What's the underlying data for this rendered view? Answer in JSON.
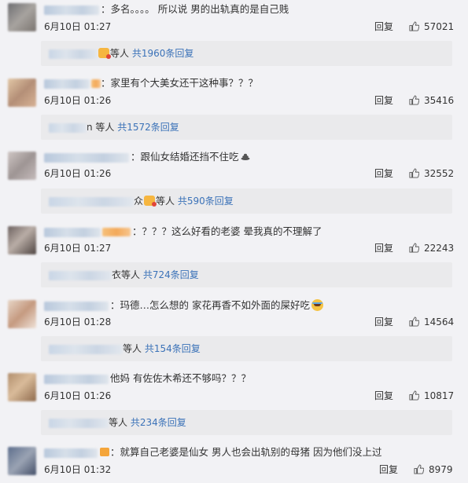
{
  "comments": [
    {
      "text": "：多名。。。。 所以说 男的出轨真的是自己贱",
      "time": "6月10日 01:27",
      "reply_label": "回复",
      "likes": "57021",
      "sub": {
        "suffix": "等人",
        "link": "共1960条回复"
      }
    },
    {
      "text": "：家里有个大美女还干这种事？？？",
      "time": "6月10日 01:26",
      "reply_label": "回复",
      "likes": "35416",
      "sub": {
        "suffix": "n 等人",
        "link": "共1572条回复"
      }
    },
    {
      "text": "：跟仙女结婚还挡不住吃",
      "time": "6月10日 01:26",
      "reply_label": "回复",
      "likes": "32552",
      "sub": {
        "suffix": "众",
        "suffix2": "等人",
        "link": "共590条回复"
      }
    },
    {
      "text": "：？？？这么好看的老婆 晕我真的不理解了",
      "time": "6月10日 01:27",
      "reply_label": "回复",
      "likes": "22243",
      "sub": {
        "suffix": "衣等人",
        "link": "共724条回复"
      }
    },
    {
      "text": "：玛德…怎么想的 家花再香不如外面的屎好吃",
      "time": "6月10日 01:28",
      "reply_label": "回复",
      "likes": "14564",
      "sub": {
        "suffix": "等人",
        "link": "共154条回复"
      }
    },
    {
      "text": "他妈 有佐佐木希还不够吗？？？",
      "time": "6月10日 01:26",
      "reply_label": "回复",
      "likes": "10817",
      "sub": {
        "suffix": "等人",
        "link": "共234条回复"
      }
    },
    {
      "text": "：就算自己老婆是仙女 男人也会出轨别的母猪 因为他们没上过",
      "time": "6月10日 01:32",
      "reply_label": "回复",
      "likes": "8979"
    }
  ]
}
